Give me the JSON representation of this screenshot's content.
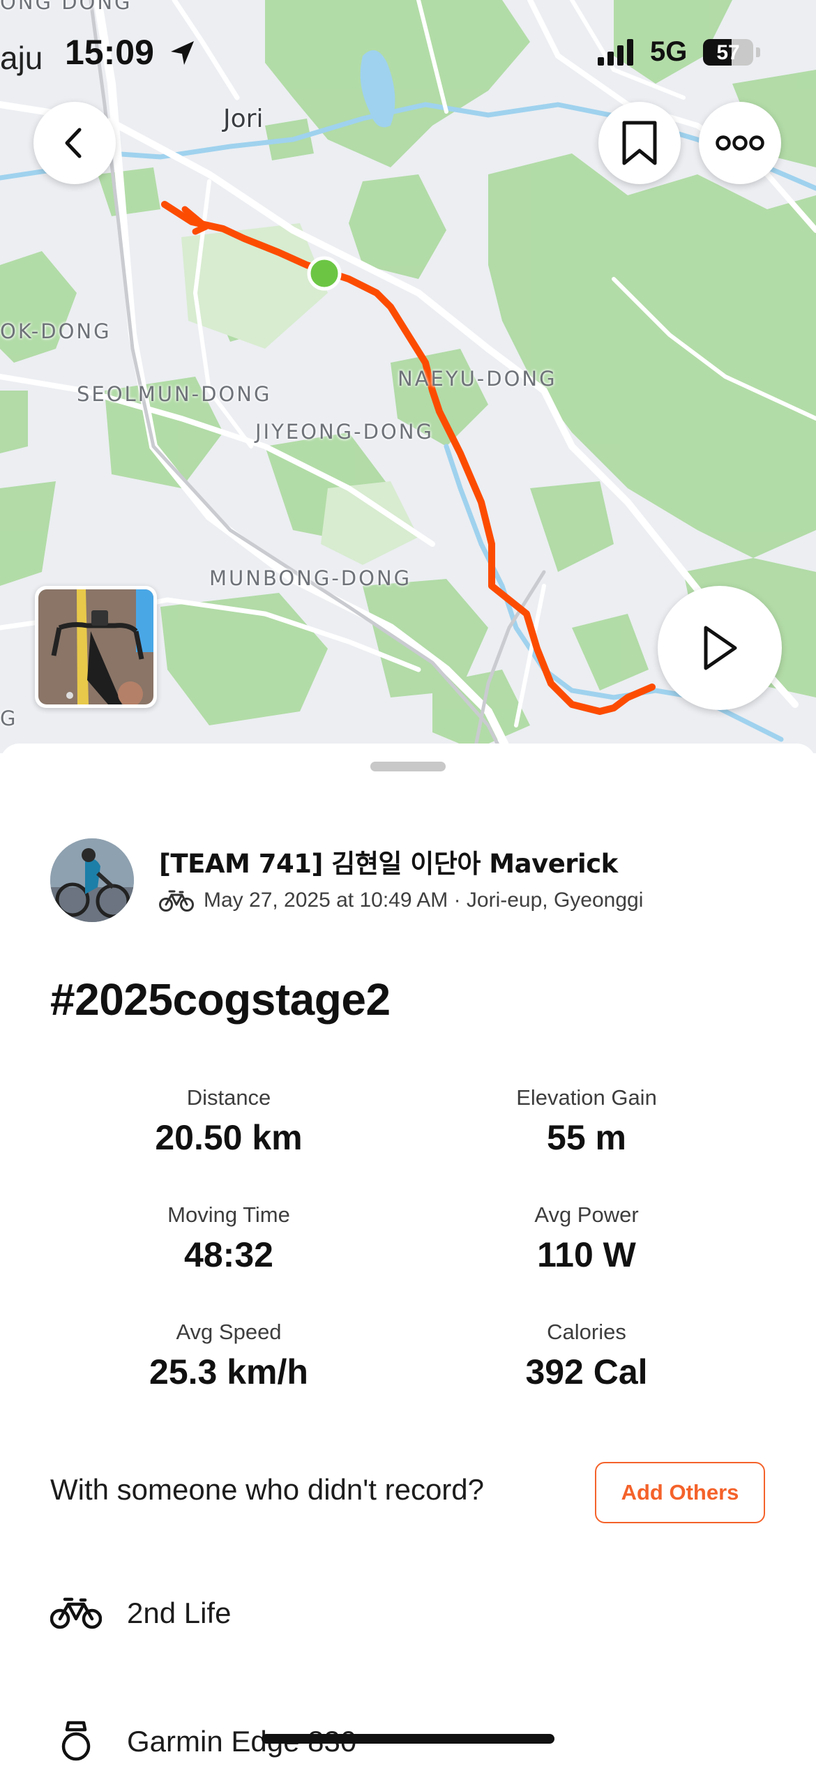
{
  "status_bar": {
    "time": "15:09",
    "left_fragment": "aju",
    "network": "5G",
    "battery": "57"
  },
  "map": {
    "labels": {
      "top_fragment": "ONG DONG",
      "jori": "Jori",
      "ok_dong": "OK-DONG",
      "seolmun": "SEOLMUN-DONG",
      "naeyu": "NAEYU-DONG",
      "jiyeong": "JIYEONG-DONG",
      "munbong": "MUNBONG-DONG",
      "left_g": "G"
    },
    "colors": {
      "route": "#fc4c02",
      "start": "#6cc644",
      "forest": "#a8d89a",
      "water": "#9fd2ee"
    }
  },
  "activity": {
    "athlete": "[TEAM 741] 김현일 이단아 Maverick",
    "meta": "May 27, 2025 at 10:49 AM · Jori-eup, Gyeonggi",
    "title": "#2025cogstage2",
    "stats": [
      {
        "label": "Distance",
        "value": "20.50 km"
      },
      {
        "label": "Elevation Gain",
        "value": "55 m"
      },
      {
        "label": "Moving Time",
        "value": "48:32"
      },
      {
        "label": "Avg Power",
        "value": "110 W"
      },
      {
        "label": "Avg Speed",
        "value": "25.3 km/h"
      },
      {
        "label": "Calories",
        "value": "392 Cal"
      }
    ],
    "with_someone": "With someone who didn't record?",
    "add_others": "Add Others",
    "bike": "2nd Life",
    "device": "Garmin Edge 830"
  },
  "accent_color": "#f4622a"
}
